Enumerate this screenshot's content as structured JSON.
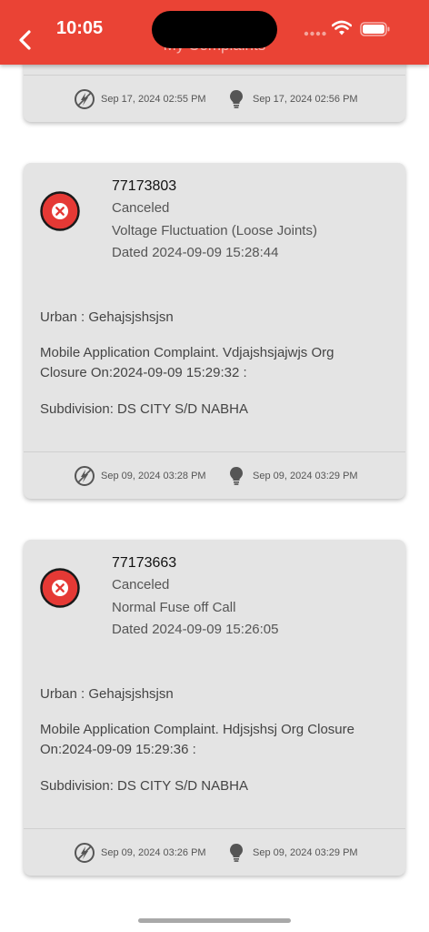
{
  "status_bar": {
    "time": "10:05"
  },
  "header": {
    "title": "My Complaints"
  },
  "colors": {
    "accent": "#ea4335",
    "card": "#e4e4e4",
    "cancel_red": "#e53935"
  },
  "cards": [
    {
      "footer": {
        "created": "Sep 17, 2024 02:55 PM",
        "resolved": "Sep 17, 2024 02:56 PM"
      }
    },
    {
      "number": "77173803",
      "status": "Canceled",
      "type": "Voltage Fluctuation (Loose Joints)",
      "dated": "Dated 2024-09-09 15:28:44",
      "area": "Urban : Gehajsjshsjsn",
      "remark": "Mobile Application Complaint. Vdjajshsjajwjs Org Closure On:2024-09-09 15:29:32 :",
      "subdivision": "Subdivision: DS CITY S/D NABHA",
      "footer": {
        "created": "Sep 09, 2024 03:28 PM",
        "resolved": "Sep 09, 2024 03:29 PM"
      }
    },
    {
      "number": "77173663",
      "status": "Canceled",
      "type": "Normal Fuse off Call",
      "dated": "Dated 2024-09-09 15:26:05",
      "area": "Urban : Gehajsjshsjsn",
      "remark": "Mobile Application Complaint. Hdjsjshsj Org Closure On:2024-09-09 15:29:36 :",
      "subdivision": "Subdivision: DS CITY S/D NABHA",
      "footer": {
        "created": "Sep 09, 2024 03:26 PM",
        "resolved": "Sep 09, 2024 03:29 PM"
      }
    }
  ],
  "icons": {
    "back": "chevron-left-icon",
    "created": "power-icon",
    "resolved": "bulb-icon",
    "status": "cancel-icon"
  }
}
